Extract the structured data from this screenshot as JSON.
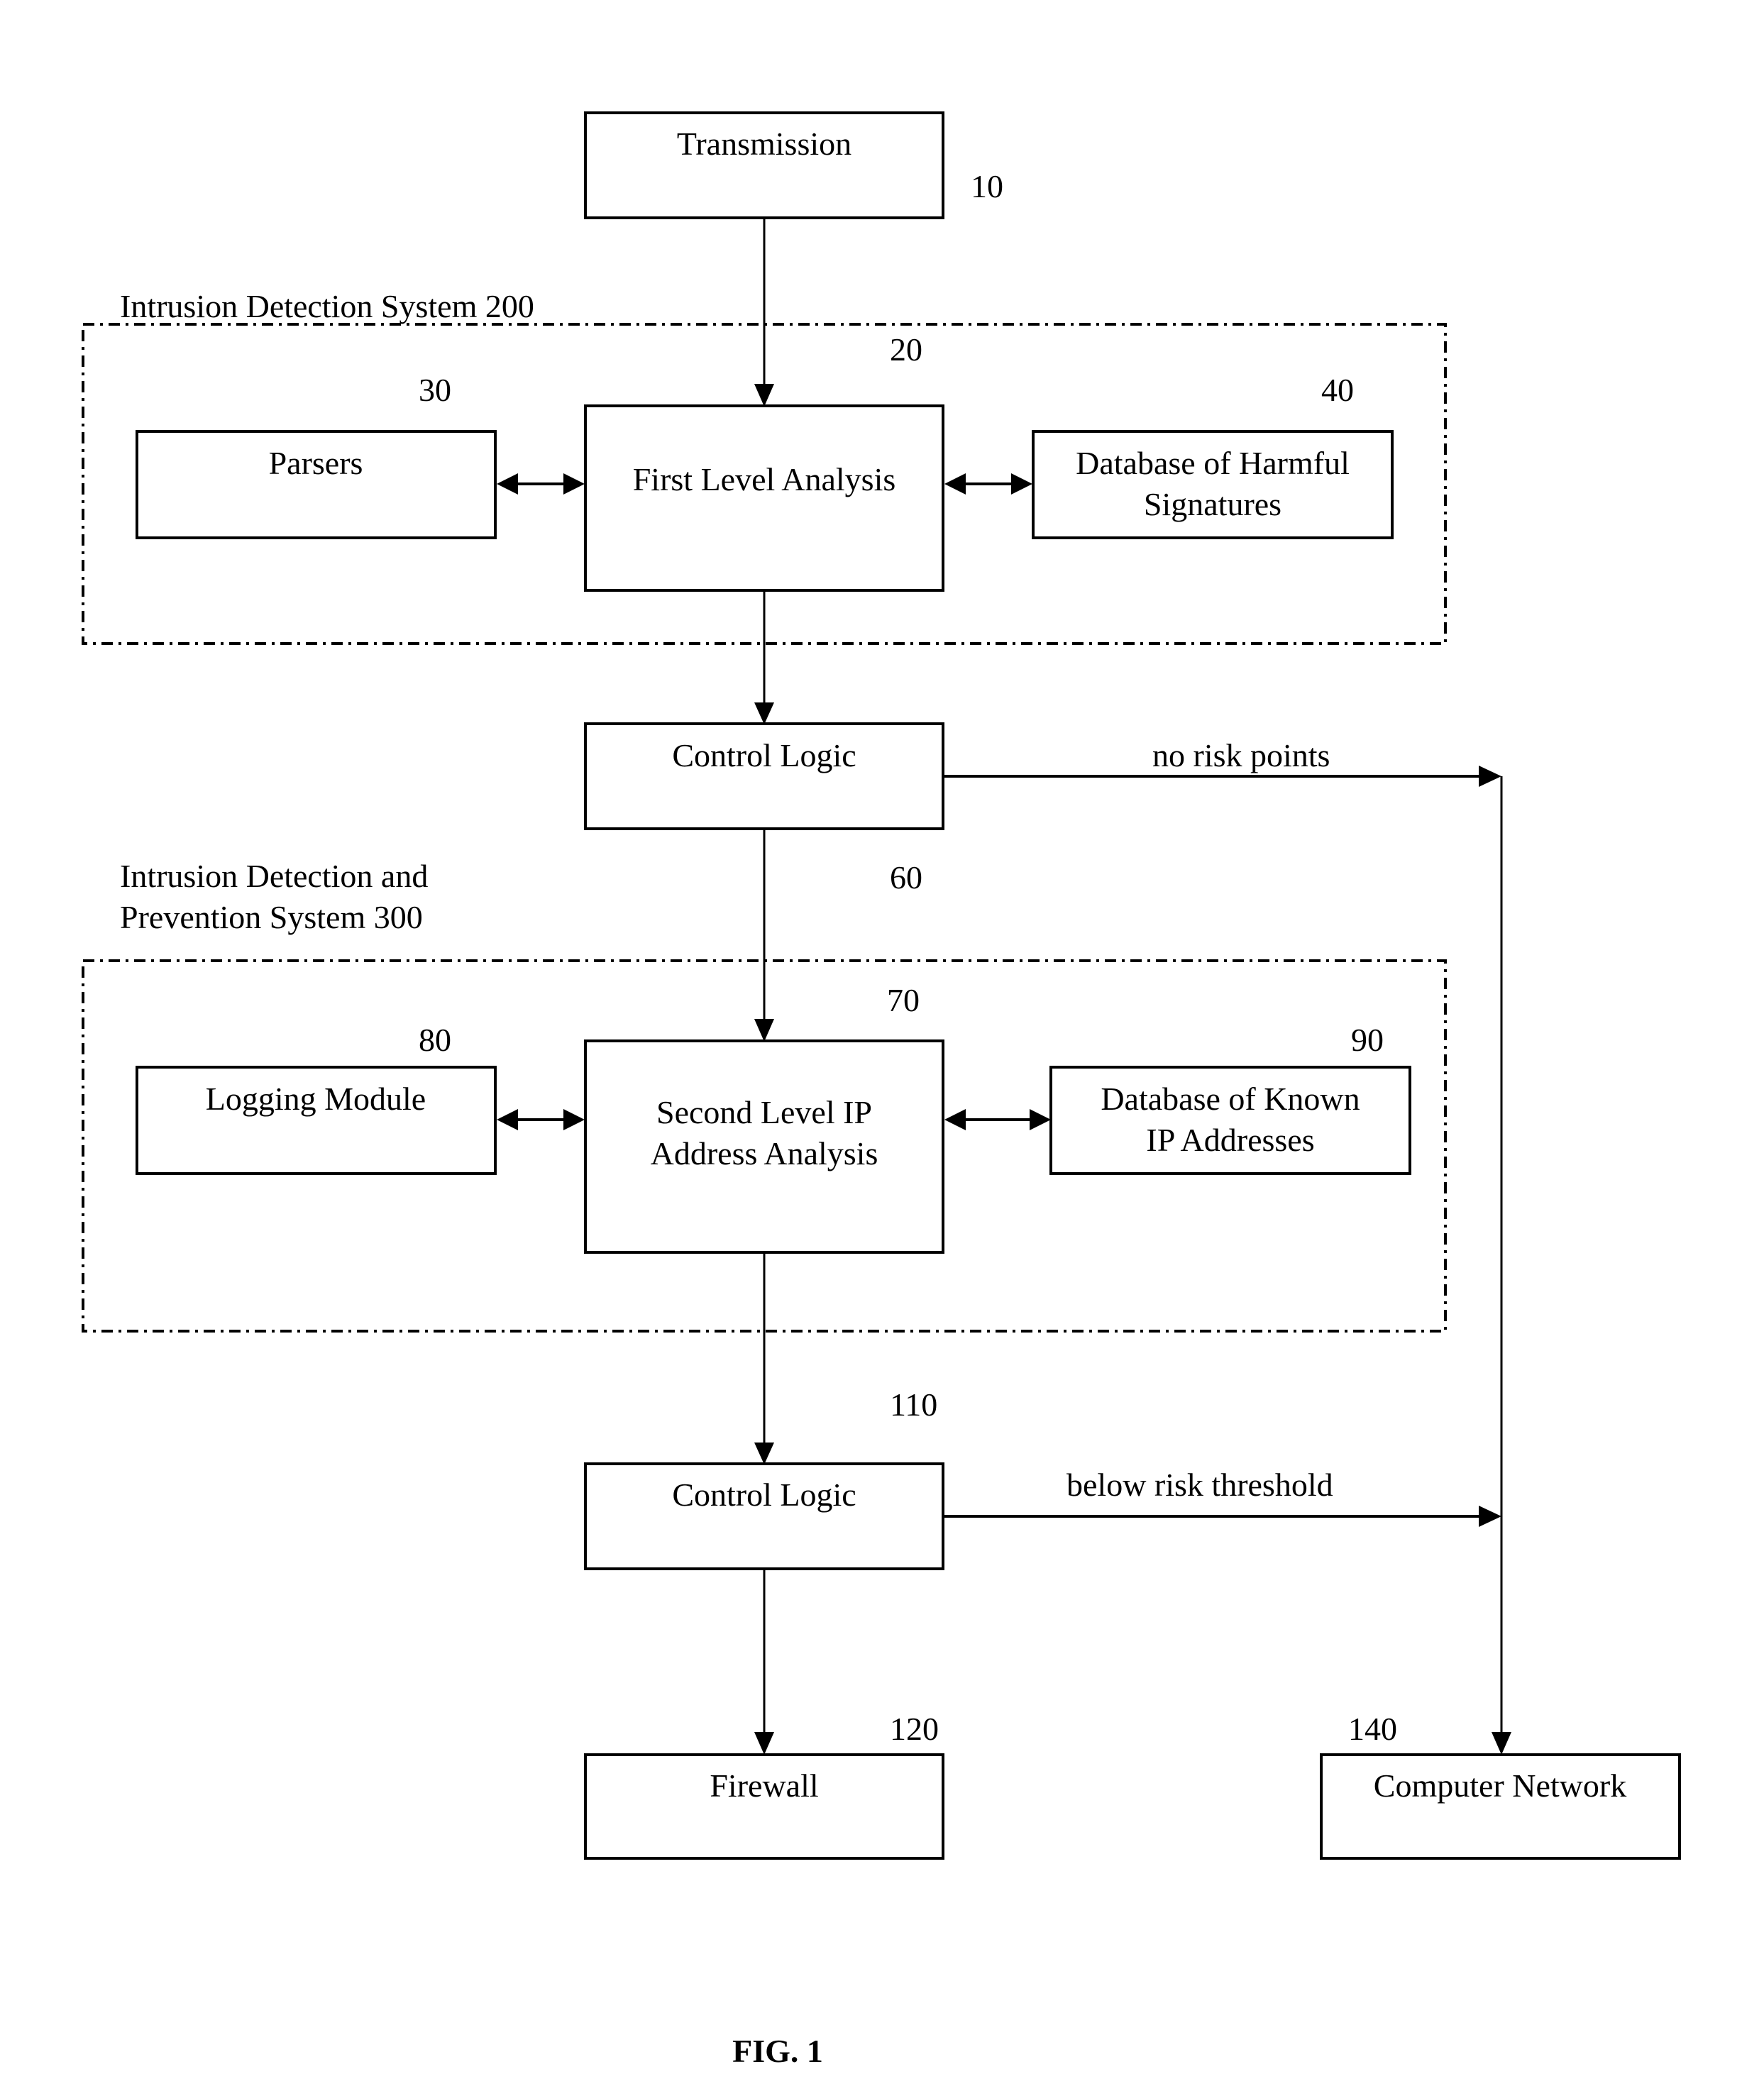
{
  "figure": {
    "caption": "FIG. 1"
  },
  "containers": {
    "ids": {
      "label": "Intrusion Detection System 200"
    },
    "idps": {
      "label_line1": "Intrusion Detection and",
      "label_line2": "Prevention System 300"
    }
  },
  "nodes": {
    "transmission": {
      "label": "Transmission",
      "ref": "10"
    },
    "first_level_analysis": {
      "label": "First Level Analysis",
      "ref": "20"
    },
    "parsers": {
      "label": "Parsers",
      "ref": "30"
    },
    "db_harmful": {
      "label_line1": "Database of Harmful",
      "label_line2": "Signatures",
      "ref": "40"
    },
    "control_logic_1": {
      "label": "Control Logic",
      "ref": "60"
    },
    "second_level": {
      "label_line1": "Second Level IP",
      "label_line2": "Address Analysis",
      "ref": "70"
    },
    "logging": {
      "label": "Logging Module",
      "ref": "80"
    },
    "db_known_ip": {
      "label_line1": "Database of Known",
      "label_line2": "IP Addresses",
      "ref": "90"
    },
    "control_logic_2": {
      "label": "Control Logic",
      "ref": "110"
    },
    "firewall": {
      "label": "Firewall",
      "ref": "120"
    },
    "computer_network": {
      "label": "Computer Network",
      "ref": "140"
    }
  },
  "edges": {
    "no_risk": {
      "label": "no risk points"
    },
    "below_threshold": {
      "label": "below risk threshold"
    }
  }
}
